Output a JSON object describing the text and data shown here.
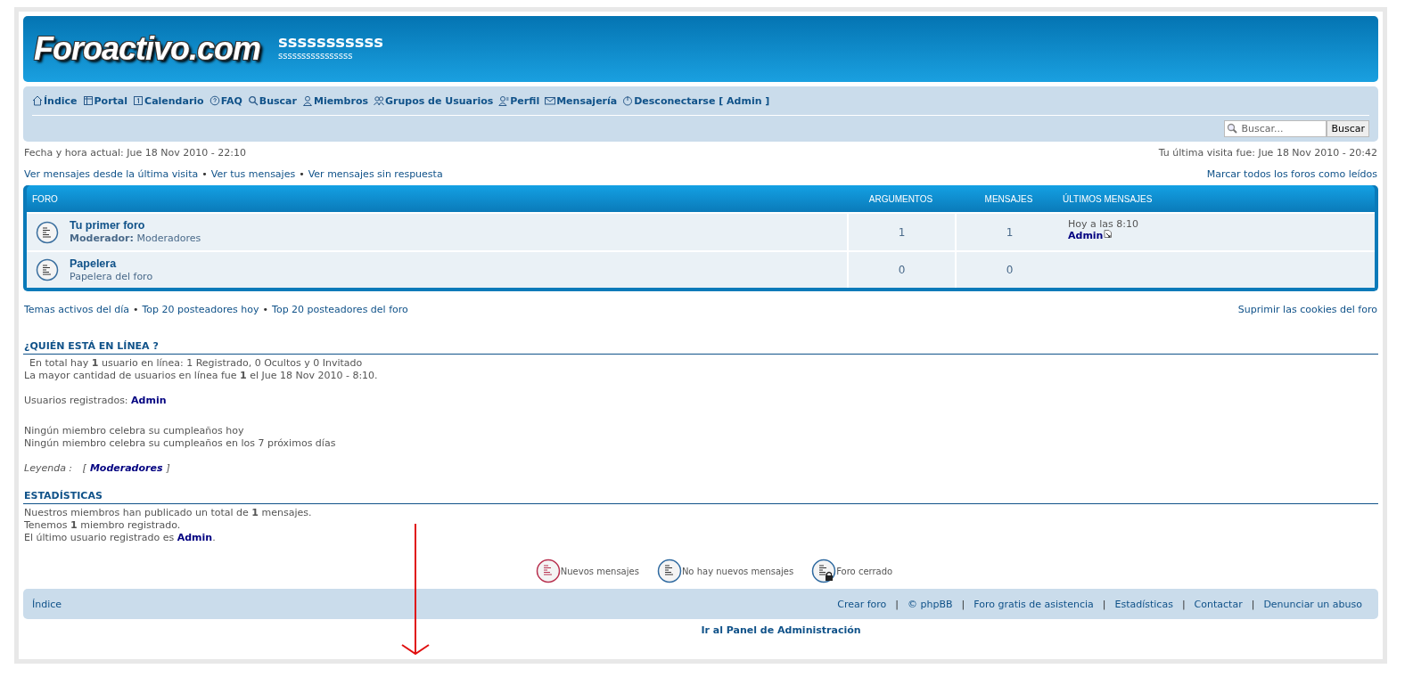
{
  "header": {
    "logo": "Foroactivo.com",
    "site_title": "sssssssssss",
    "site_description": "ssssssssssssssss"
  },
  "nav": [
    "Índice",
    "Portal",
    "Calendario",
    "FAQ",
    "Buscar",
    "Miembros",
    "Grupos de Usuarios",
    "Perfil",
    "Mensajería",
    "Desconectarse [ Admin ]"
  ],
  "search": {
    "placeholder": "Buscar...",
    "button": "Buscar"
  },
  "current_time": "Fecha y hora actual: Jue 18 Nov 2010 - 22:10",
  "last_visit": "Tu última visita fue: Jue 18 Nov 2010 - 20:42",
  "separator": "•",
  "top_links": [
    "Ver mensajes desde la última visita",
    "Ver tus mensajes",
    "Ver mensajes sin respuesta"
  ],
  "mark_read": "Marcar todos los foros como leídos",
  "forum_table": {
    "columns": [
      "FORO",
      "ARGUMENTOS",
      "MENSAJES",
      "ÚLTIMOS MENSAJES"
    ],
    "rows": [
      {
        "title": "Tu primer foro",
        "description": "**Moderador:** Moderadores",
        "topics": "1",
        "posts": "1",
        "last_post_time": "Hoy a las 8:10",
        "last_post_user": "Admin"
      },
      {
        "title": "Papelera",
        "description": "Papelera del foro",
        "topics": "0",
        "posts": "0"
      }
    ]
  },
  "bottom_links": [
    "Temas activos del día",
    "Top 20 posteadores hoy",
    "Top 20 posteadores del foro"
  ],
  "delete_cookies": "Suprimir las cookies del foro",
  "who_online": {
    "title": "¿QUIÉN ESTÁ EN LÍNEA ?",
    "lines": [
      "En total hay **1** usuario en línea: 1 Registrado, 0 Ocultos y 0 Invitado",
      "La mayor cantidad de usuarios en línea fue **1** el Jue 18 Nov 2010 - 8:10."
    ],
    "registered_label": "Usuarios registrados:",
    "registered_user": "Admin",
    "birthdays": [
      "Ningún miembro celebra su cumpleaños hoy",
      "Ningún miembro celebra su cumpleaños en los 7 próximos días"
    ],
    "legend_label": "Leyenda :",
    "legend_open": "[",
    "legend_group": "Moderadores",
    "legend_close": "]"
  },
  "stats": {
    "title": "ESTADÍSTICAS",
    "lines": [
      "Nuestros miembros han publicado un total de **1** mensajes.",
      "Tenemos **1** miembro registrado."
    ],
    "last_user_before": "El último usuario registrado es",
    "last_user": "Admin",
    "last_user_after": "."
  },
  "legend_icons": [
    {
      "label": "Nuevos mensajes",
      "kind": "new"
    },
    {
      "label": "No hay nuevos mensajes",
      "kind": "none"
    },
    {
      "label": "Foro cerrado",
      "kind": "locked"
    }
  ],
  "footer": {
    "index": "Índice",
    "separator": "|",
    "links": [
      "Crear foro",
      "© phpBB",
      "Foro gratis de asistencia",
      "Estadísticas",
      "Contactar",
      "Denunciar un abuso"
    ]
  },
  "admin_panel": "Ir al Panel de Administración"
}
